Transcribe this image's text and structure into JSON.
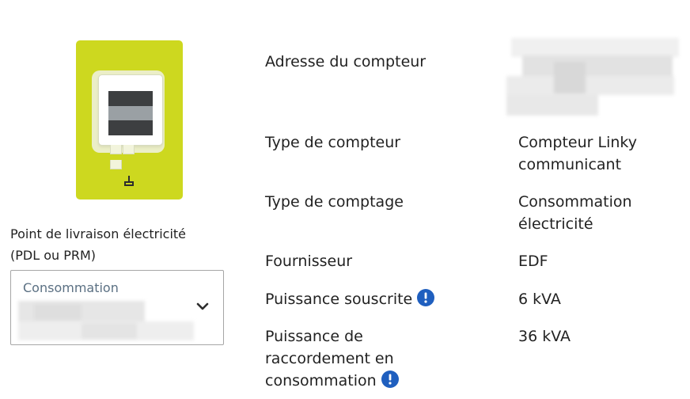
{
  "meter_card": {
    "label_line1": "Point de livraison électricité",
    "label_line2": "(PDL ou PRM)",
    "tile_color": "#cdd81f",
    "icon": "electric-socket-icon"
  },
  "select": {
    "caption": "Consommation",
    "icon": "chevron-down-icon"
  },
  "rows": [
    {
      "label": "Adresse du compteur",
      "value": ""
    },
    {
      "label": "Type de compteur",
      "value_line1": "Compteur Linky",
      "value_line2": "communicant"
    },
    {
      "label": "Type de comptage",
      "value_line1": "Consommation",
      "value_line2": "électricité"
    },
    {
      "label": "Fournisseur",
      "value": "EDF"
    },
    {
      "label": "Puissance souscrite",
      "value": "6 kVA",
      "icon": "info-icon"
    },
    {
      "label_line1": "Puissance de",
      "label_line2": "raccordement en",
      "label_line3": "consommation",
      "value": "36 kVA",
      "icon": "info-icon"
    }
  ],
  "colors": {
    "info_icon": "#1f5fbf",
    "caption": "#5b7083"
  }
}
